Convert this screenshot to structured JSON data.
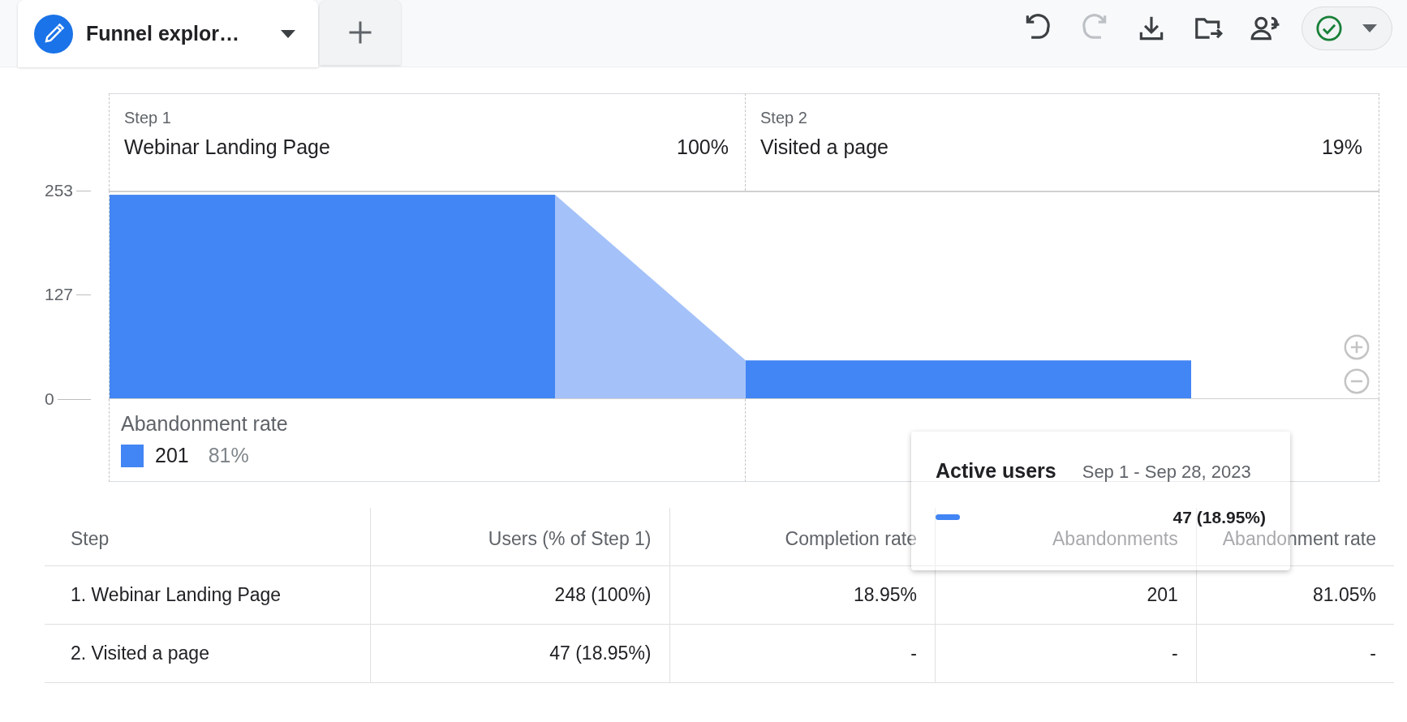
{
  "tabs": [
    {
      "label": "Funnel explor…",
      "selected": true
    }
  ],
  "toolbar": [
    {
      "kind": "undo",
      "disabled": false
    },
    {
      "kind": "redo",
      "disabled": true
    },
    {
      "kind": "download",
      "disabled": false
    },
    {
      "kind": "move",
      "disabled": false
    },
    {
      "kind": "share",
      "disabled": false
    }
  ],
  "status": {
    "kind": "ok"
  },
  "chart": {
    "steps": [
      {
        "label": "Step 1",
        "percent": "100%"
      },
      {
        "label": "Step 2",
        "percent": "19%"
      }
    ],
    "chart_data": {
      "type": "bar",
      "categories": [
        "Webinar Landing Page",
        "Visited a page"
      ],
      "series": [
        {
          "name": "Active users",
          "color": "#4285f4",
          "values": [
            248,
            47
          ]
        }
      ],
      "ylim": [
        0,
        253
      ],
      "yticks": [
        0,
        127,
        253
      ]
    },
    "abandonment": {
      "label": "Abandonment rate",
      "count": "201",
      "percent": "81%",
      "color": "#4285f4"
    }
  },
  "table": {
    "columns": [
      "Step",
      "Users (% of Step 1)",
      "Completion rate",
      "Abandonments",
      "Abandonment rate"
    ],
    "rows": [
      [
        "1. Webinar Landing Page",
        "248 (100%)",
        "18.95%",
        "201",
        "81.05%"
      ],
      [
        "2. Visited a page",
        "47 (18.95%)",
        "-",
        "-",
        "-"
      ]
    ]
  },
  "tooltip": {
    "date": "Sep 1 - Sep 28, 2023",
    "value": "47 (18.95%)",
    "color": "#4285f4"
  }
}
